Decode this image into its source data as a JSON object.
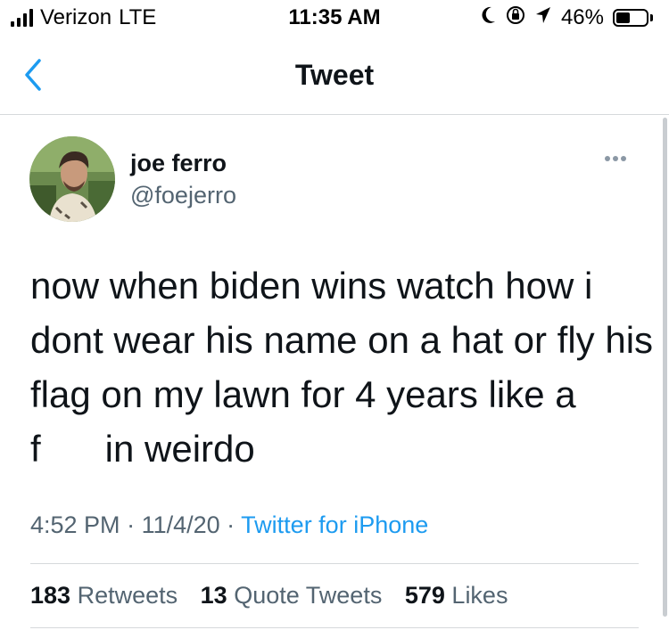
{
  "status_bar": {
    "carrier": "Verizon",
    "network": "LTE",
    "time": "11:35 AM",
    "battery": "46%",
    "battery_level": 0.46,
    "icons": [
      "signal-icon",
      "moon-icon",
      "orientation-lock-icon",
      "location-arrow-icon",
      "battery-icon"
    ]
  },
  "nav": {
    "title": "Tweet",
    "back_icon": "chevron-left-icon"
  },
  "tweet": {
    "display_name": "joe ferro",
    "handle": "@foejerro",
    "lines": [
      "now when biden wins watch how i",
      "dont wear his name on a hat or fly his",
      "flag on my lawn for 4 years like a"
    ],
    "last_line_start": "f",
    "last_line_end": "in weirdo",
    "time": "4:52 PM",
    "sep1": " · ",
    "date": "11/4/20",
    "sep2": " · ",
    "source": "Twitter for iPhone"
  },
  "stats": {
    "retweets_count": "183",
    "retweets_label": "Retweets",
    "quotes_count": "13",
    "quotes_label": "Quote Tweets",
    "likes_count": "579",
    "likes_label": "Likes"
  },
  "colors": {
    "link": "#1d9bf0",
    "secondary_text": "#536471",
    "primary_text": "#0f1419"
  }
}
